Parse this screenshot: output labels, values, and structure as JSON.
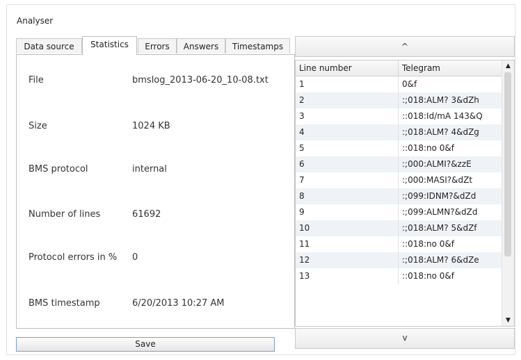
{
  "window": {
    "title": "Analyser"
  },
  "tabs": [
    {
      "label": "Data source"
    },
    {
      "label": "Statistics",
      "active": true
    },
    {
      "label": "Errors"
    },
    {
      "label": "Answers"
    },
    {
      "label": "Timestamps"
    }
  ],
  "stats": [
    {
      "label": "File",
      "value": "bmslog_2013-06-20_10-08.txt"
    },
    {
      "label": "Size",
      "value": "1024 KB"
    },
    {
      "label": "BMS protocol",
      "value": "internal"
    },
    {
      "label": "Number of lines",
      "value": "61692"
    },
    {
      "label": "Protocol errors in %",
      "value": "0"
    },
    {
      "label": "BMS timestamp",
      "value": "6/20/2013 10:27 AM"
    }
  ],
  "buttons": {
    "save": "Save",
    "scroll_up": "^",
    "scroll_down": "v"
  },
  "table": {
    "columns": [
      "Line number",
      "Telegram"
    ],
    "rows": [
      [
        "1",
        "0&f"
      ],
      [
        "2",
        ":;018:ALM? 3&dZh"
      ],
      [
        "3",
        "::018:Id/mA 143&Q"
      ],
      [
        "4",
        ":;018:ALM? 4&dZg"
      ],
      [
        "5",
        "::018:no 0&f"
      ],
      [
        "6",
        ":;000:ALMI?&zzE"
      ],
      [
        "7",
        ":;000:MASI?&dZt"
      ],
      [
        "8",
        ":;099:IDNM?&dZd"
      ],
      [
        "9",
        ":;099:ALMN?&dZd"
      ],
      [
        "10",
        ":;018:ALM? 5&dZf"
      ],
      [
        "11",
        "::018:no 0&f"
      ],
      [
        "12",
        ":;018:ALM? 6&dZe"
      ],
      [
        "13",
        "::018:no 0&f"
      ]
    ]
  },
  "scrollbar": {
    "up_glyph": "▲",
    "down_glyph": "▼"
  }
}
